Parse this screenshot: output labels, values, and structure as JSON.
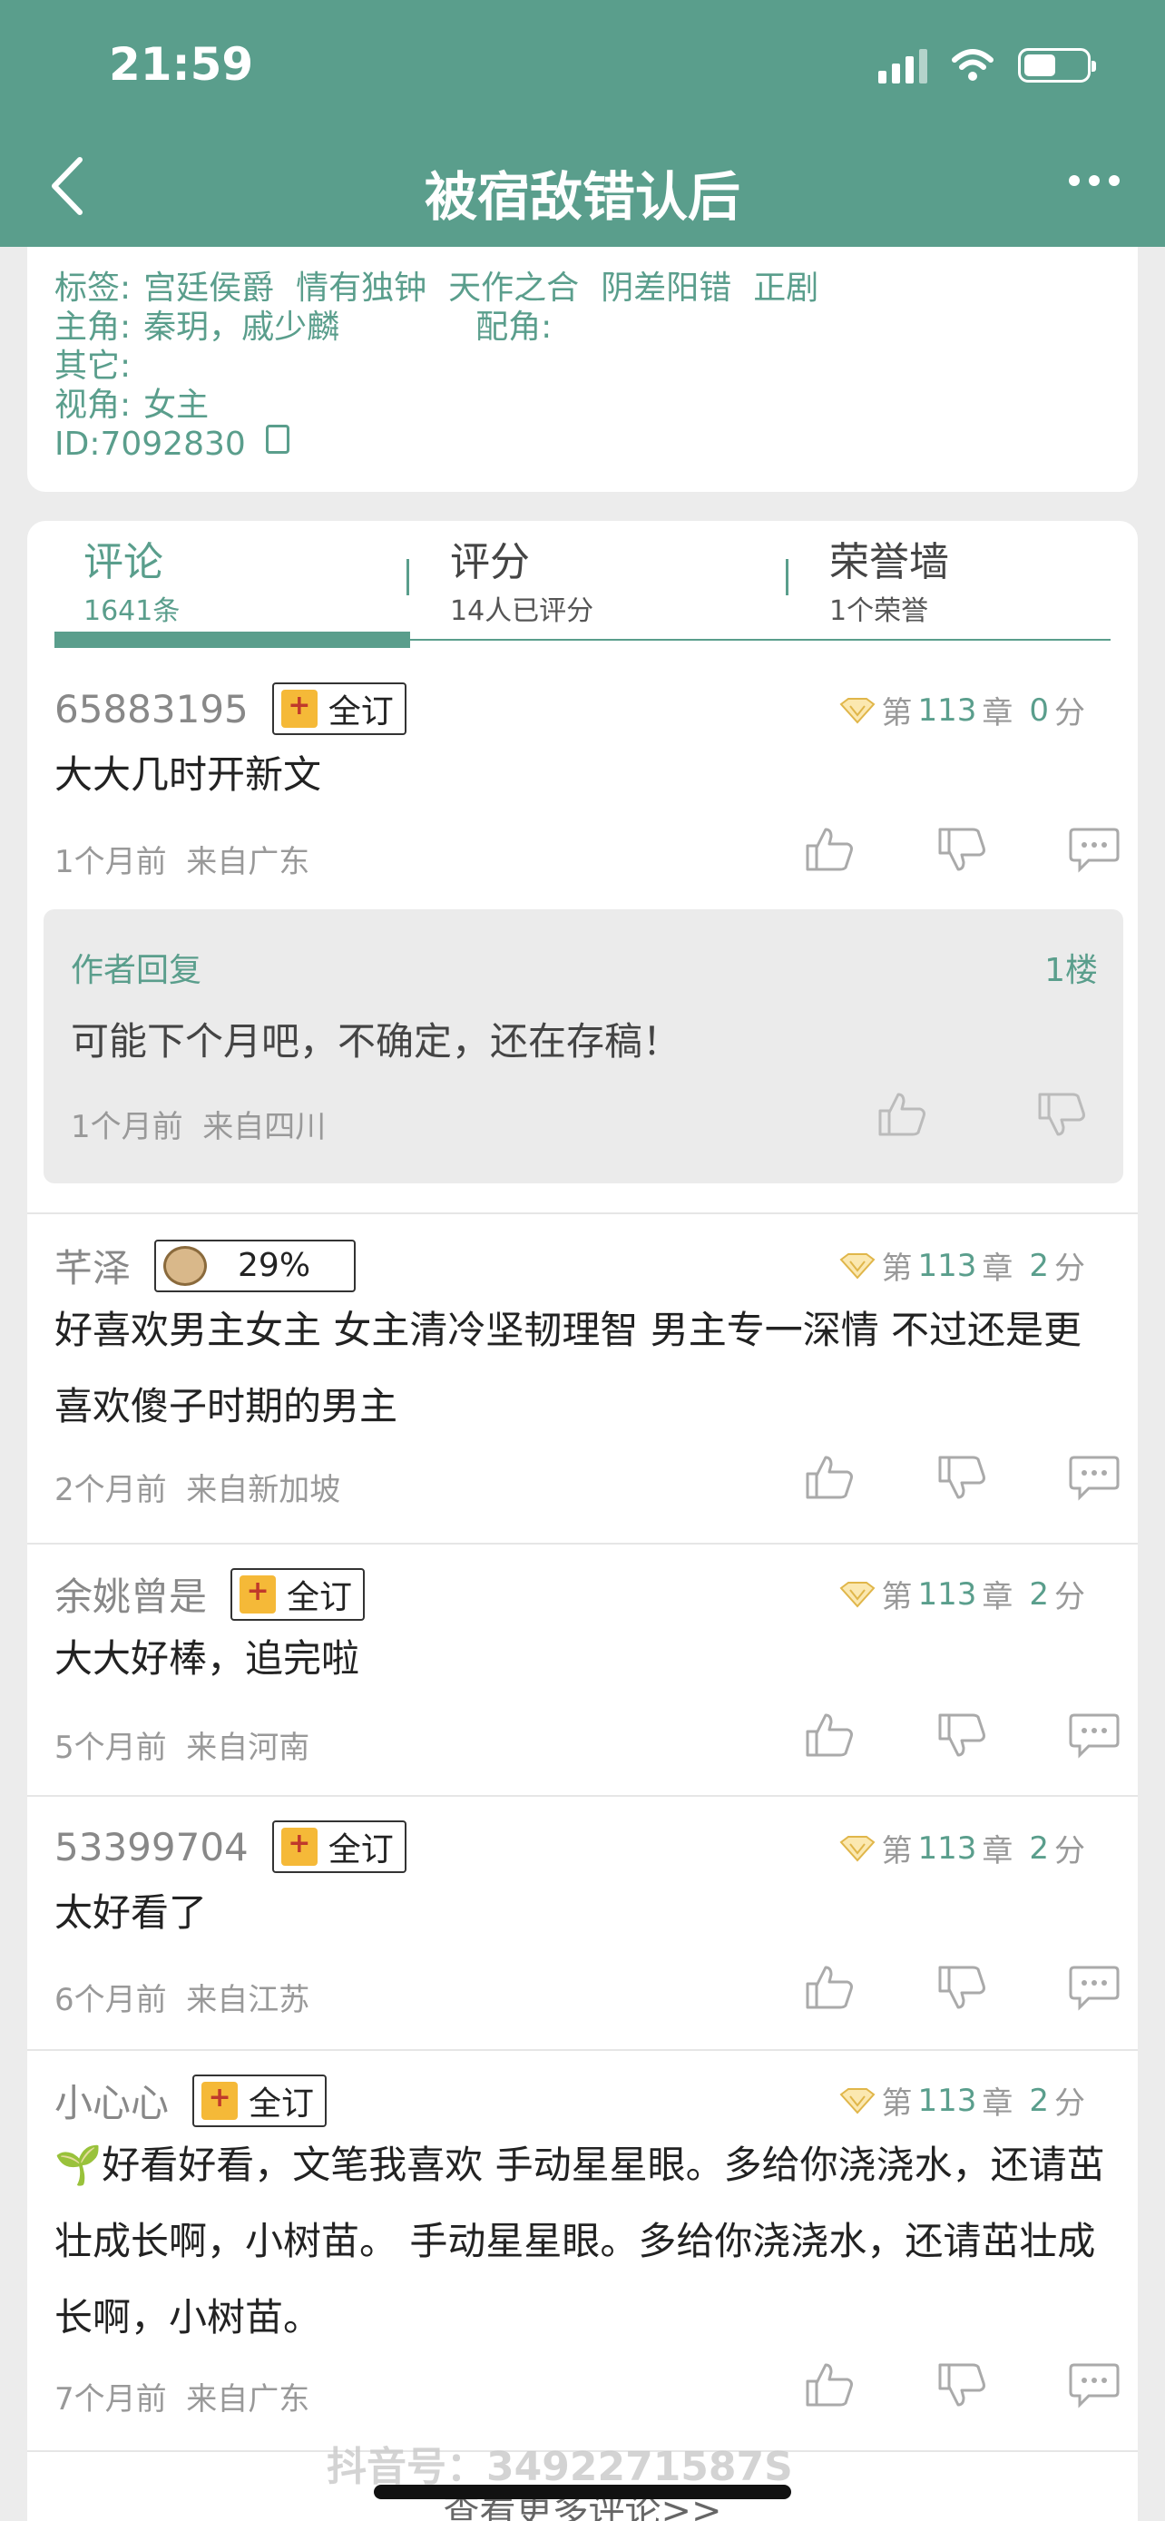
{
  "status_bar": {
    "time": "21:59"
  },
  "nav": {
    "title": "被宿敌错认后"
  },
  "info": {
    "tags_label": "标签:",
    "tags": [
      "宫廷侯爵",
      "情有独钟",
      "天作之合",
      "阴差阳错",
      "正剧"
    ],
    "protagonist_label": "主角:",
    "protagonist": "秦玥，戚少麟",
    "supporting_label": "配角:",
    "other_label": "其它:",
    "pov_label": "视角:",
    "pov": "女主",
    "id": "ID:7092830"
  },
  "tabs": [
    {
      "label": "评论",
      "sub": "1641条"
    },
    {
      "label": "评分",
      "sub": "14人已评分"
    },
    {
      "label": "荣誉墙",
      "sub": "1个荣誉"
    }
  ],
  "comments": [
    {
      "user": "65883195",
      "badge": "全订",
      "chapter_prefix": "第",
      "chapter": "113",
      "chapter_suffix": "章",
      "score": "0",
      "score_suffix": "分",
      "body": "大大几时开新文",
      "time": "1个月前",
      "location": "来自广东",
      "reply": {
        "label": "作者回复",
        "floor": "1楼",
        "text": "可能下个月吧，不确定，还在存稿！",
        "time": "1个月前",
        "location": "来自四川"
      }
    },
    {
      "user": "芊泽",
      "badge": "29%",
      "chapter_prefix": "第",
      "chapter": "113",
      "chapter_suffix": "章",
      "score": "2",
      "score_suffix": "分",
      "body": "好喜欢男主女主 女主清冷坚韧理智 男主专一深情 不过还是更喜欢傻子时期的男主",
      "time": "2个月前",
      "location": "来自新加坡"
    },
    {
      "user": "余姚曾是",
      "badge": "全订",
      "chapter_prefix": "第",
      "chapter": "113",
      "chapter_suffix": "章",
      "score": "2",
      "score_suffix": "分",
      "body": "大大好棒，追完啦",
      "time": "5个月前",
      "location": "来自河南"
    },
    {
      "user": "53399704",
      "badge": "全订",
      "chapter_prefix": "第",
      "chapter": "113",
      "chapter_suffix": "章",
      "score": "2",
      "score_suffix": "分",
      "body": "太好看了",
      "time": "6个月前",
      "location": "来自江苏"
    },
    {
      "user": "小心心",
      "badge": "全订",
      "chapter_prefix": "第",
      "chapter": "113",
      "chapter_suffix": "章",
      "score": "2",
      "score_suffix": "分",
      "body": "🌱好看好看，文笔我喜欢 手动星星眼。多给你浇浇水，还请茁壮成长啊，小树苗。 手动星星眼。多给你浇浇水，还请茁壮成长啊，小树苗。",
      "time": "7个月前",
      "location": "来自广东"
    }
  ],
  "more_comments": "查看更多评论>>",
  "watermark": "抖音号：3492271587S",
  "colors": {
    "brand": "#5a9e8c",
    "badge_gold": "#f5b938"
  }
}
